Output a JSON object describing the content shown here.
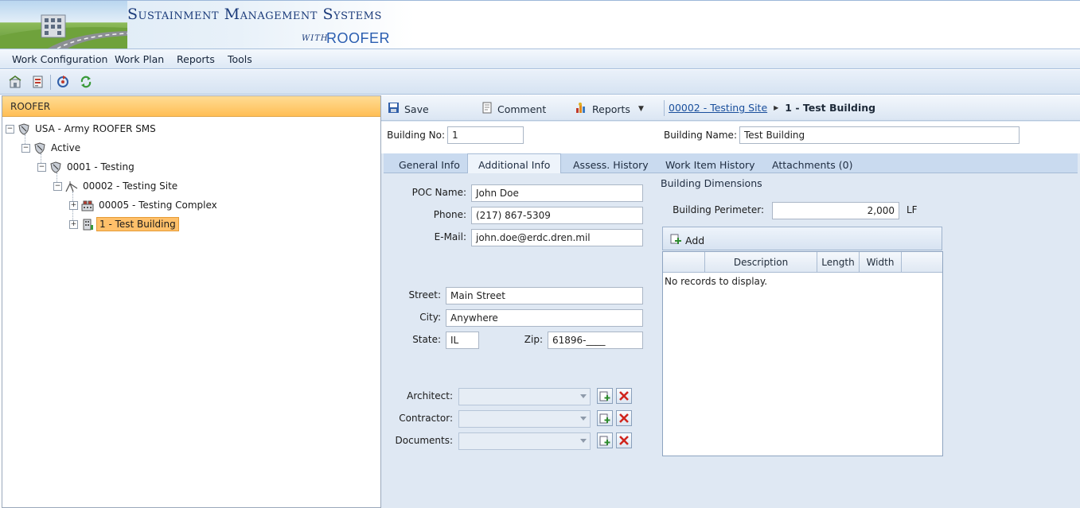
{
  "banner": {
    "title": "Sustainment Management Systems",
    "with": "WITH",
    "product": "ROOFER"
  },
  "menu": {
    "items": [
      {
        "label": "Work Configuration"
      },
      {
        "label": "Work Plan"
      },
      {
        "label": "Reports"
      },
      {
        "label": "Tools"
      }
    ]
  },
  "toolbar": {
    "icons": [
      "inventory-icon",
      "report-icon",
      "refresh-icon",
      "sync-icon"
    ]
  },
  "left_panel": {
    "header": "ROOFER",
    "tree": [
      {
        "label": "USA - Army ROOFER SMS",
        "icon": "shield-icon",
        "level": 0
      },
      {
        "label": "Active",
        "icon": "shield-icon",
        "level": 1
      },
      {
        "label": "0001 - Testing",
        "icon": "shield-icon",
        "level": 2
      },
      {
        "label": "00002 - Testing Site",
        "icon": "site-icon",
        "level": 3
      },
      {
        "label": "00005 - Testing Complex",
        "icon": "complex-icon",
        "level": 4
      },
      {
        "label": "1 - Test Building",
        "icon": "building-icon",
        "level": 4,
        "selected": true
      }
    ]
  },
  "actions": {
    "save": "Save",
    "comment": "Comment",
    "reports": "Reports",
    "breadcrumb_link": "00002 - Testing Site",
    "breadcrumb_current": "1 - Test Building"
  },
  "building": {
    "no_label": "Building No:",
    "no_value": "1",
    "name_label": "Building Name:",
    "name_value": "Test Building"
  },
  "tabs": [
    {
      "label": "General Info"
    },
    {
      "label": "Additional Info",
      "active": true
    },
    {
      "label": "Assess. History"
    },
    {
      "label": "Work Item History"
    },
    {
      "label": "Attachments (0)"
    }
  ],
  "form": {
    "poc_name_label": "POC Name:",
    "poc_name": "John Doe",
    "phone_label": "Phone:",
    "phone": "(217) 867-5309",
    "email_label": "E-Mail:",
    "email": "john.doe@erdc.dren.mil",
    "street_label": "Street:",
    "street": "Main Street",
    "city_label": "City:",
    "city": "Anywhere",
    "state_label": "State:",
    "state": "IL",
    "zip_label": "Zip:",
    "zip": "61896-____",
    "architect_label": "Architect:",
    "contractor_label": "Contractor:",
    "documents_label": "Documents:"
  },
  "dimensions": {
    "title": "Building Dimensions",
    "perimeter_label": "Building Perimeter:",
    "perimeter_value": "2,000",
    "unit": "LF",
    "add_label": "Add",
    "columns": [
      "Description",
      "Length",
      "Width"
    ],
    "empty_text": "No records to display."
  },
  "colors": {
    "accent": "#ffbe55",
    "panel_bg": "#dfe8f3",
    "link": "#1a4f9c"
  }
}
